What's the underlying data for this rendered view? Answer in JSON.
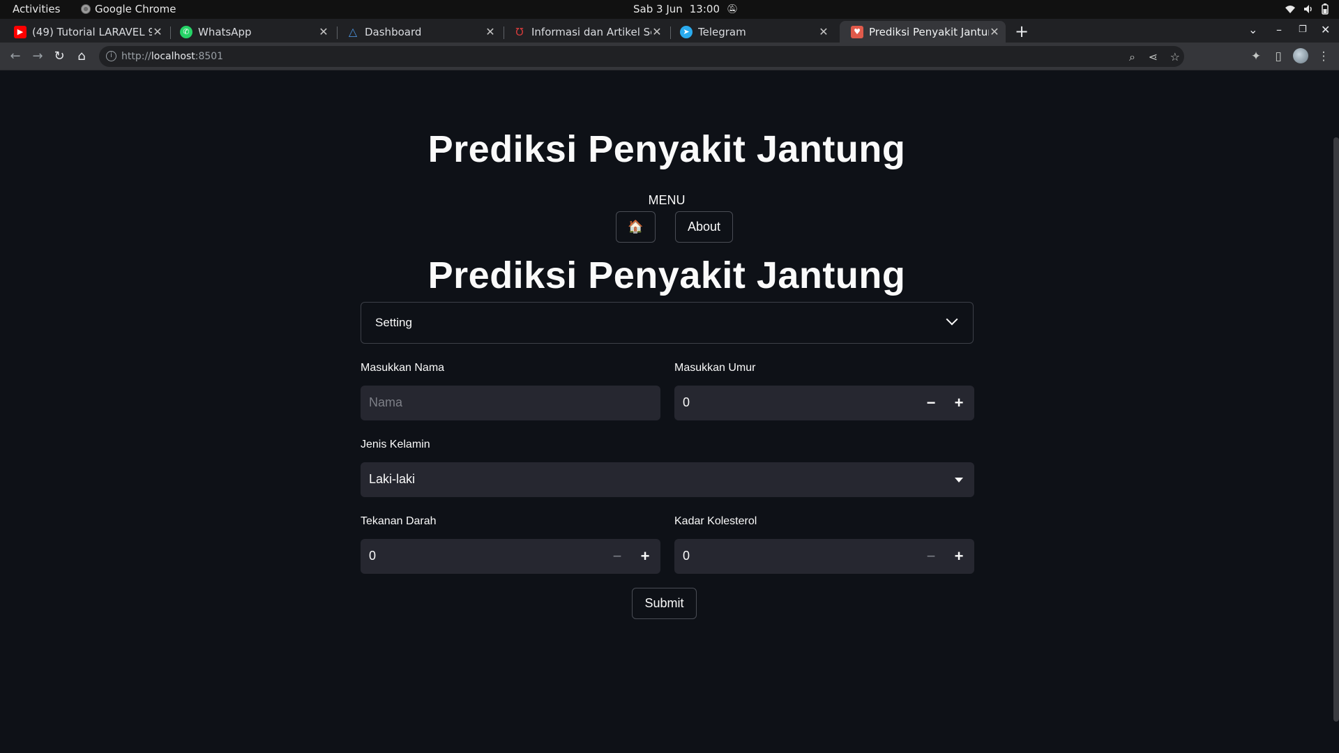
{
  "system_bar": {
    "activities": "Activities",
    "app_name": "Google Chrome",
    "date": "Sab 3 Jun",
    "time": "13:00"
  },
  "tabs": [
    {
      "title": "(49) Tutorial LARAVEL 9 : F",
      "icon": "youtube-icon",
      "color": "#ff0000"
    },
    {
      "title": "WhatsApp",
      "icon": "whatsapp-icon",
      "color": "#25d366"
    },
    {
      "title": "Dashboard",
      "icon": "dashboard-icon",
      "color": "#4a90d9"
    },
    {
      "title": "Informasi dan Artikel Sep",
      "icon": "stethoscope-icon",
      "color": "#d23b3b"
    },
    {
      "title": "Telegram",
      "icon": "telegram-icon",
      "color": "#2aabee"
    },
    {
      "title": "Prediksi Penyakit Jantung",
      "icon": "heart-icon",
      "color": "#e05a4b"
    }
  ],
  "address_bar": {
    "scheme": "http://",
    "host": "localhost",
    "port": ":8501"
  },
  "app": {
    "title": "Prediksi Penyakit Jantung",
    "menu_label": "MENU",
    "home_button": "🏠",
    "about_button": "About",
    "section_title": "Prediksi Penyakit Jantung",
    "expander_label": "Setting",
    "fields": {
      "nama": {
        "label": "Masukkan Nama",
        "placeholder": "Nama",
        "value": ""
      },
      "umur": {
        "label": "Masukkan Umur",
        "value": "0"
      },
      "jenis_kelamin": {
        "label": "Jenis Kelamin",
        "value": "Laki-laki"
      },
      "tekanan_darah": {
        "label": "Tekanan Darah",
        "value": "0"
      },
      "kolesterol": {
        "label": "Kadar Kolesterol",
        "value": "0"
      }
    },
    "submit_label": "Submit"
  },
  "colors": {
    "background": "#0e1117",
    "input_bg": "#262730",
    "text": "#fafafa"
  }
}
